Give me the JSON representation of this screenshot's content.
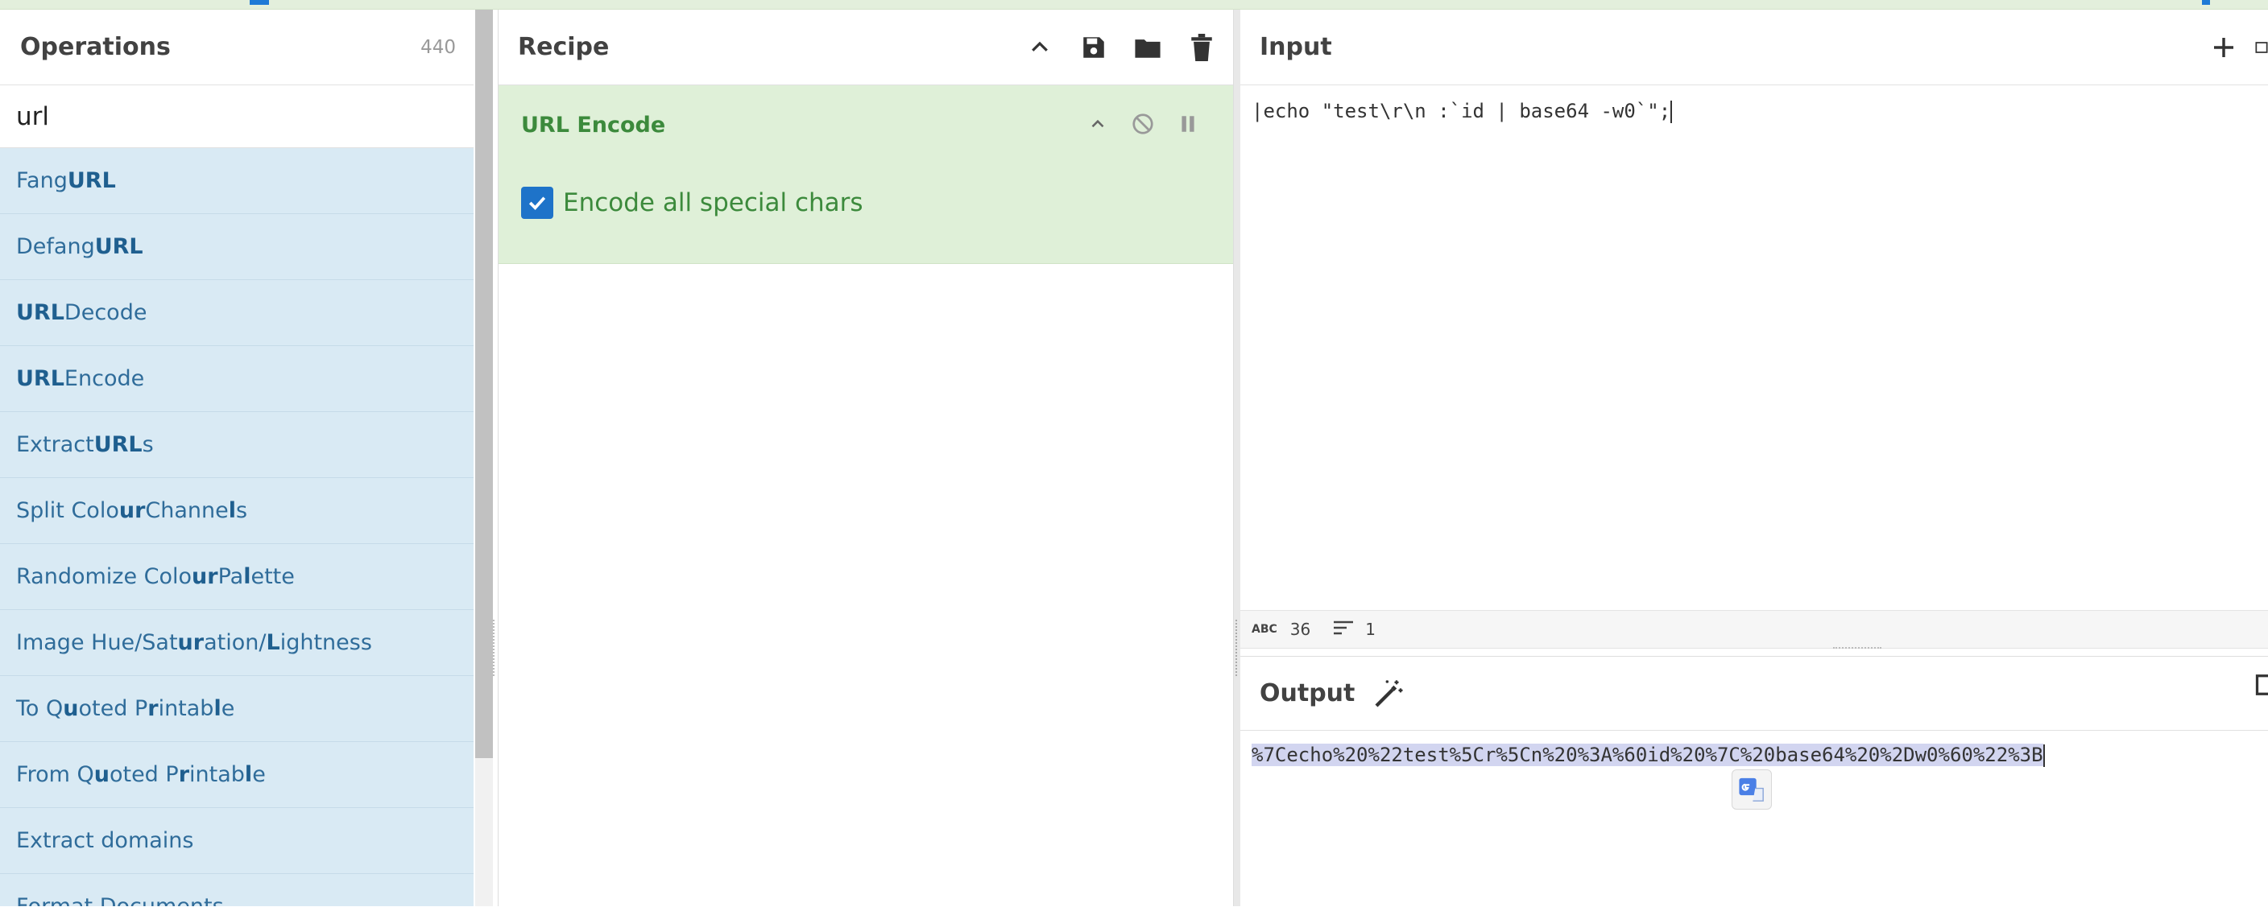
{
  "operations": {
    "title": "Operations",
    "count": "440",
    "search_value": "url",
    "items": [
      {
        "parts": [
          [
            "Fang ",
            false
          ],
          [
            "URL",
            true
          ]
        ]
      },
      {
        "parts": [
          [
            "Defang ",
            false
          ],
          [
            "URL",
            true
          ]
        ]
      },
      {
        "parts": [
          [
            "URL",
            true
          ],
          [
            " Decode",
            false
          ]
        ]
      },
      {
        "parts": [
          [
            "URL",
            true
          ],
          [
            " Encode",
            false
          ]
        ]
      },
      {
        "parts": [
          [
            "Extract ",
            false
          ],
          [
            "URL",
            true
          ],
          [
            "s",
            false
          ]
        ]
      },
      {
        "parts": [
          [
            "Split Colo",
            false
          ],
          [
            "ur",
            true
          ],
          [
            " Channe",
            false
          ],
          [
            "l",
            true
          ],
          [
            "s",
            false
          ]
        ]
      },
      {
        "parts": [
          [
            "Randomize Colo",
            false
          ],
          [
            "ur",
            true
          ],
          [
            " Pa",
            false
          ],
          [
            "l",
            true
          ],
          [
            "ette",
            false
          ]
        ]
      },
      {
        "parts": [
          [
            "Image Hue/Sat",
            false
          ],
          [
            "ur",
            true
          ],
          [
            "ation/",
            false
          ],
          [
            "L",
            true
          ],
          [
            "ightness",
            false
          ]
        ]
      },
      {
        "parts": [
          [
            "To Q",
            false
          ],
          [
            "u",
            true
          ],
          [
            "oted P",
            false
          ],
          [
            "r",
            true
          ],
          [
            "intab",
            false
          ],
          [
            "l",
            true
          ],
          [
            "e",
            false
          ]
        ]
      },
      {
        "parts": [
          [
            "From Q",
            false
          ],
          [
            "u",
            true
          ],
          [
            "oted P",
            false
          ],
          [
            "r",
            true
          ],
          [
            "intab",
            false
          ],
          [
            "l",
            true
          ],
          [
            "e",
            false
          ]
        ]
      },
      {
        "parts": [
          [
            "Extract domains",
            false
          ]
        ]
      },
      {
        "parts": [
          [
            "Format Documents",
            false
          ]
        ]
      }
    ]
  },
  "recipe": {
    "title": "Recipe",
    "operation": {
      "title": "URL Encode",
      "option_label": "Encode all special chars",
      "option_checked": true
    }
  },
  "input": {
    "title": "Input",
    "text": "|echo \"test\\r\\n :`id | base64 -w0`\";",
    "status_length_icon": "ABC",
    "status_length": "36",
    "status_lines": "1"
  },
  "output": {
    "title": "Output",
    "text": "%7Cecho%20%22test%5Cr%5Cn%20%3A%60id%20%7C%20base64%20%2Dw0%60%22%3B"
  },
  "icons": {
    "collapse": "chevron-up-icon",
    "save": "save-icon",
    "load": "folder-icon",
    "clear": "trash-icon",
    "disable": "disable-icon",
    "pause": "pause-icon",
    "magic": "magic-wand-icon",
    "add": "plus-icon"
  },
  "colors": {
    "op_item_bg": "#d9eaf4",
    "recipe_card_bg": "#dff0d8",
    "accent_green": "#3c8a3c",
    "checkbox_blue": "#1e73c9",
    "selection": "#d2d5f0"
  }
}
